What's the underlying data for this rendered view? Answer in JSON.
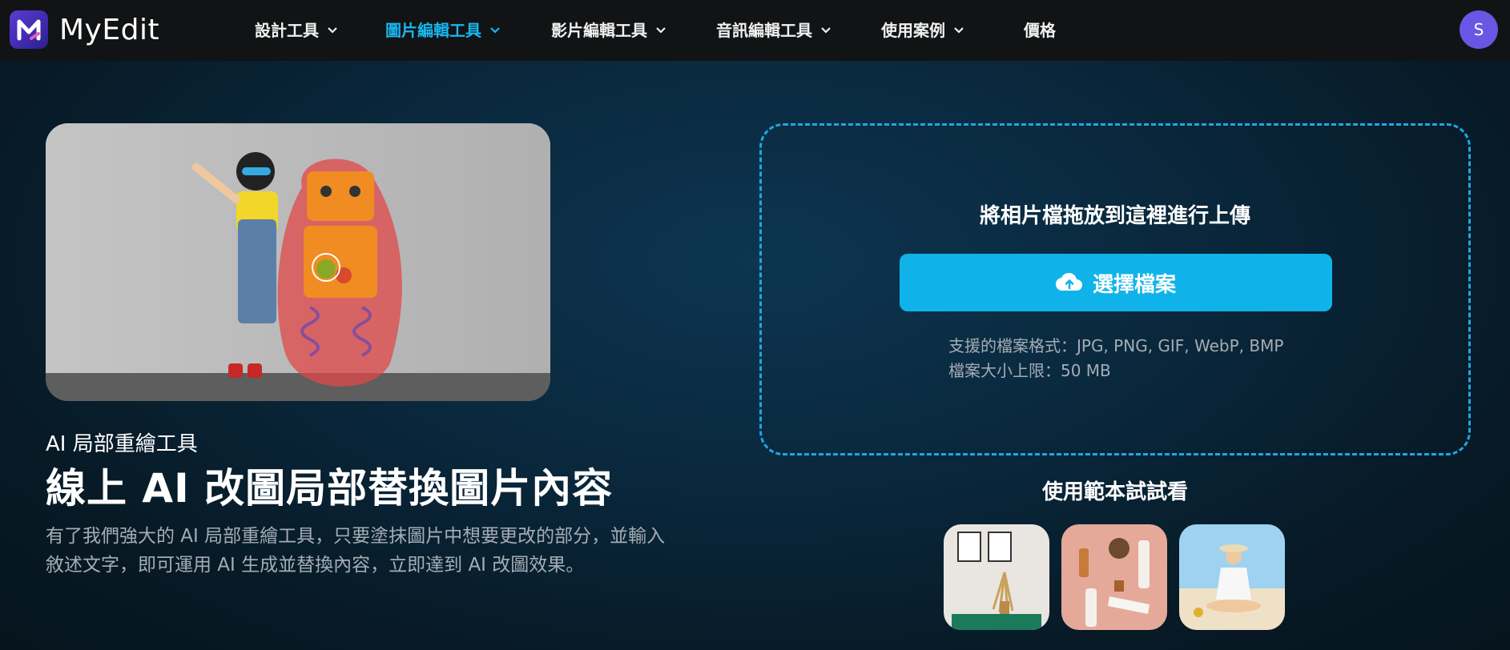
{
  "app": {
    "name": "MyEdit"
  },
  "nav": {
    "items": [
      {
        "label": "設計工具",
        "active": false
      },
      {
        "label": "圖片編輯工具",
        "active": true
      },
      {
        "label": "影片編輯工具",
        "active": false
      },
      {
        "label": "音訊編輯工具",
        "active": false
      },
      {
        "label": "使用案例",
        "active": false
      },
      {
        "label": "價格",
        "active": false
      }
    ],
    "avatar_initial": "S"
  },
  "hero": {
    "subtitle": "AI 局部重繪工具",
    "title": "線上 AI 改圖局部替換圖片內容",
    "description": "有了我們強大的 AI 局部重繪工具，只要塗抹圖片中想要更改的部分，並輸入敘述文字，即可運用 AI 生成並替換內容，立即達到 AI 改圖效果。"
  },
  "upload": {
    "heading": "將相片檔拖放到這裡進行上傳",
    "button_label": "選擇檔案",
    "formats_line": "支援的檔案格式：JPG, PNG, GIF, WebP, BMP",
    "size_line": "檔案大小上限：50 MB"
  },
  "samples": {
    "title": "使用範本試試看"
  },
  "colors": {
    "accent": "#0fb3ea",
    "active_nav": "#19b6ee",
    "avatar": "#6b55e4",
    "topbar": "#111315"
  }
}
